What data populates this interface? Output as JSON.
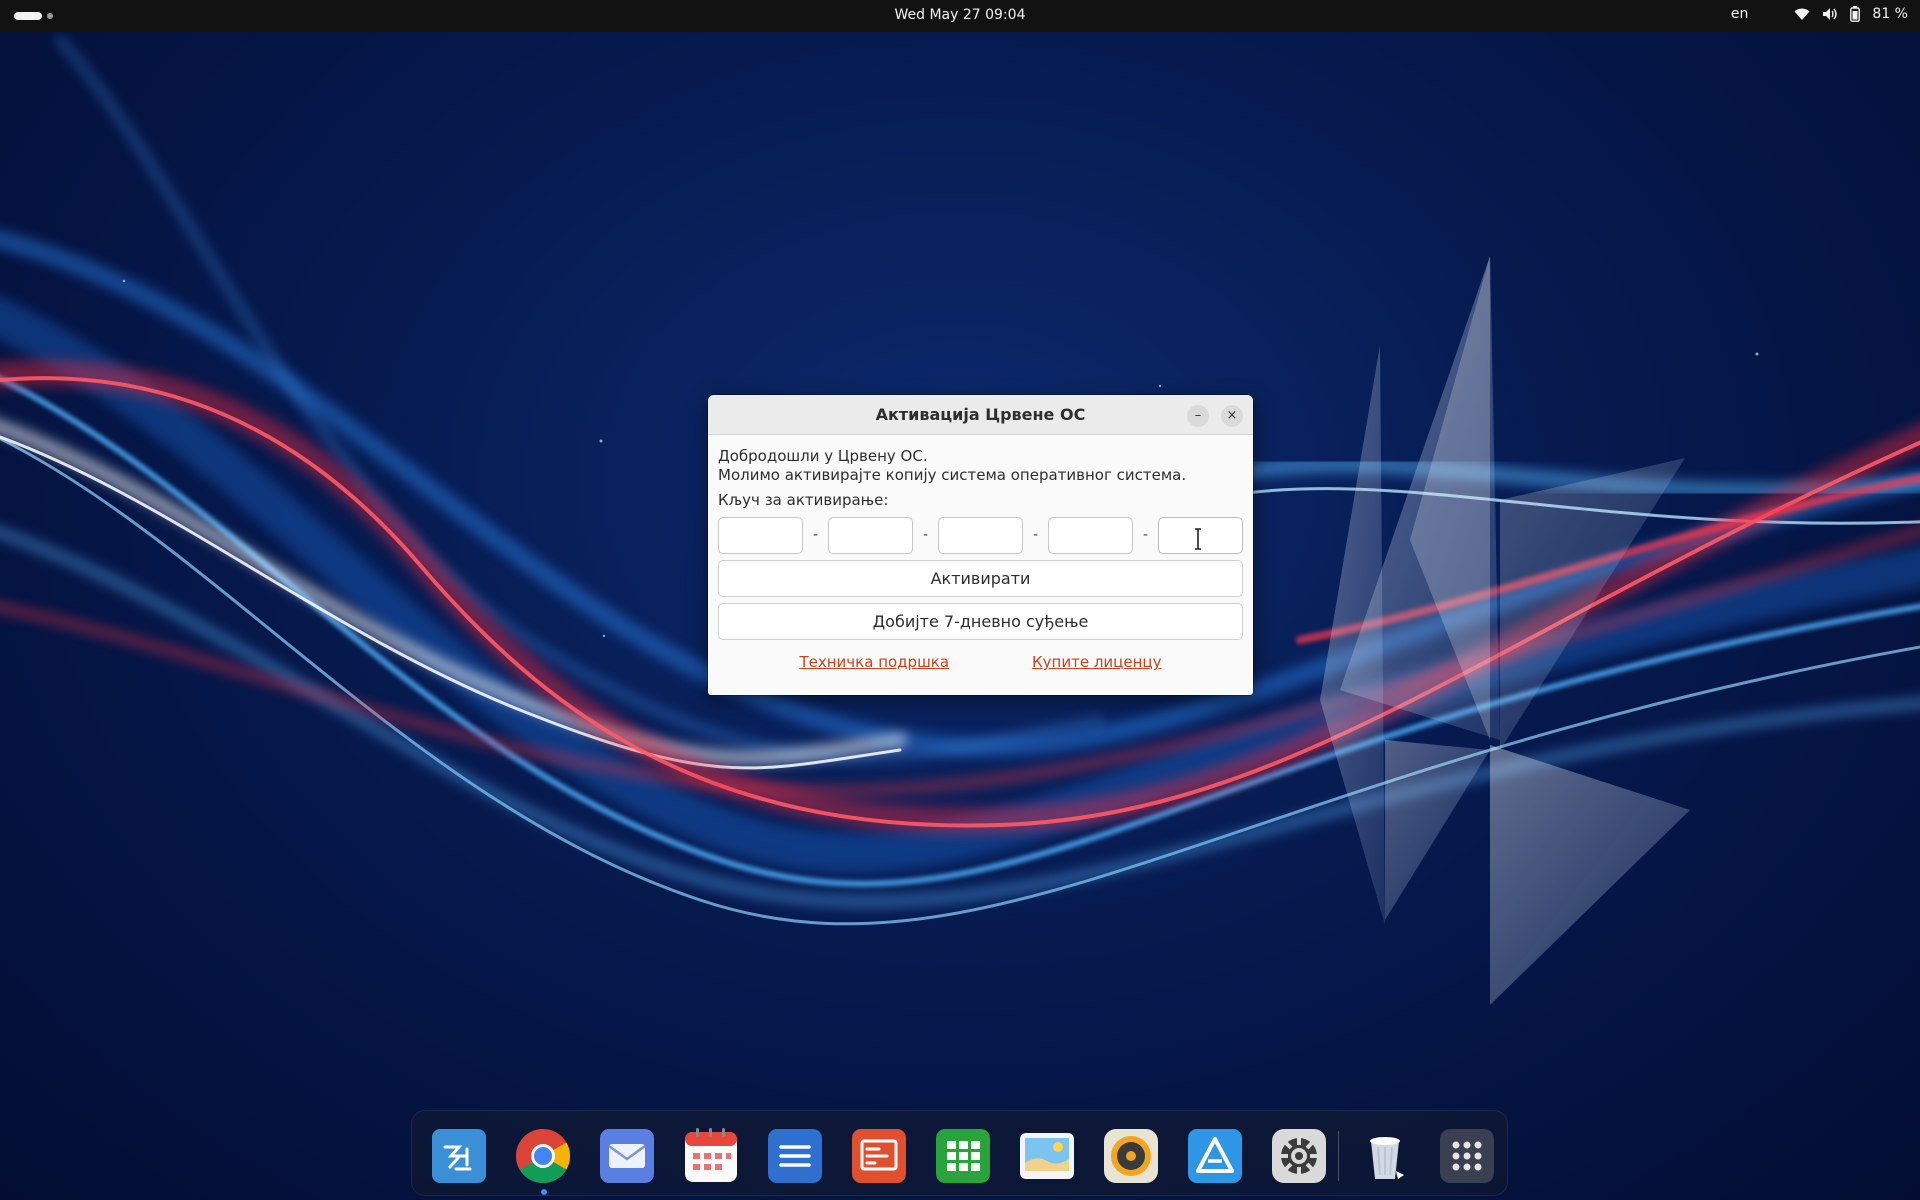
{
  "topbar": {
    "clock": "Wed May 27  09:04",
    "language": "en",
    "battery_percent": "81 %"
  },
  "dialog": {
    "title": "Активација Црвене ОС",
    "welcome_line1": "Добродошли у Црвену ОС.",
    "welcome_line2": "Молимо активирајте копију система оперативног система.",
    "key_label": "Кључ за активирање:",
    "key_fields": [
      "",
      "",
      "",
      "",
      ""
    ],
    "separator": "-",
    "activate_label": "Активирати",
    "trial_label": "Добијте 7-дневно суђење",
    "support_link": "Техничка подршка",
    "buy_link": "Купите лиценцу",
    "minimize_symbol": "–",
    "close_symbol": "×"
  },
  "dock": {
    "items": [
      {
        "icon": "app-center-icon"
      },
      {
        "icon": "chrome-icon",
        "running": true
      },
      {
        "icon": "mail-icon"
      },
      {
        "icon": "calendar-icon"
      },
      {
        "icon": "writer-icon"
      },
      {
        "icon": "presentation-icon"
      },
      {
        "icon": "spreadsheet-icon"
      },
      {
        "icon": "image-viewer-icon"
      },
      {
        "icon": "music-player-icon"
      },
      {
        "icon": "software-store-icon"
      },
      {
        "icon": "settings-icon"
      },
      {
        "icon": "trash-icon"
      },
      {
        "icon": "show-apps-icon"
      }
    ]
  },
  "colors": {
    "topbar_bg": "#121212",
    "link": "#c7441d",
    "accent_blue": "#3d8ef0"
  }
}
